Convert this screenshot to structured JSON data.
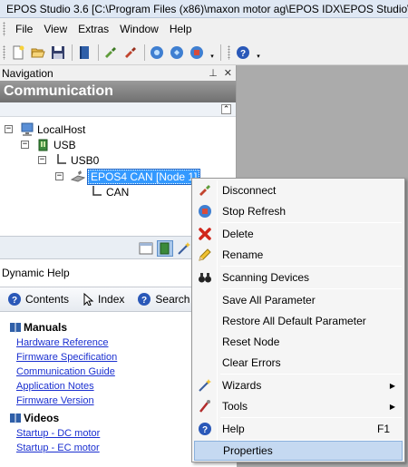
{
  "window": {
    "title": "EPOS Studio 3.6 [C:\\Program Files (x86)\\maxon motor ag\\EPOS IDX\\EPOS Studio\\"
  },
  "menubar": {
    "items": [
      {
        "label": "File"
      },
      {
        "label": "View"
      },
      {
        "label": "Extras"
      },
      {
        "label": "Window"
      },
      {
        "label": "Help"
      }
    ]
  },
  "toolbar": {
    "dropdown_glyph": "▾",
    "buttons": [
      "new-file-icon",
      "open-folder-icon",
      "save-icon",
      "book-icon",
      "connect-icon",
      "disconnect-icon",
      "node-1-icon",
      "node-2-icon",
      "node-3-icon",
      "help-icon"
    ]
  },
  "navigation": {
    "title": "Navigation",
    "pin_glyph": "⊥",
    "close_glyph": "✕",
    "panel_title": "Communication",
    "collapse_glyph": "⌃",
    "tree": [
      {
        "label": "LocalHost",
        "expander": "−"
      },
      {
        "label": "USB",
        "expander": "−"
      },
      {
        "label": "USB0",
        "expander": "−"
      },
      {
        "label": "EPOS4 CAN [Node 1]",
        "expander": "−",
        "selected": true
      },
      {
        "label": "CAN"
      }
    ]
  },
  "dynamic_help": {
    "title": "Dynamic Help",
    "tabs": [
      {
        "label": "Contents"
      },
      {
        "label": "Index"
      },
      {
        "label": "Search"
      }
    ],
    "sections": [
      {
        "title": "Manuals",
        "links": [
          "Hardware Reference",
          "Firmware Specification",
          "Communication Guide",
          "Application Notes",
          "Firmware Version"
        ]
      },
      {
        "title": "Videos",
        "links": [
          "Startup - DC motor",
          "Startup - EC motor"
        ]
      }
    ]
  },
  "context_menu": {
    "items": [
      {
        "label": "Disconnect",
        "icon": "disconnect-icon"
      },
      {
        "label": "Stop Refresh",
        "icon": "stop-refresh-icon"
      },
      {
        "label": "Delete",
        "icon": "delete-icon"
      },
      {
        "label": "Rename",
        "icon": "pencil-icon"
      },
      {
        "label": "Scanning Devices",
        "icon": "binoculars-icon"
      },
      {
        "label": "Save All Parameter"
      },
      {
        "label": "Restore All Default Parameter"
      },
      {
        "label": "Reset Node"
      },
      {
        "label": "Clear Errors"
      },
      {
        "label": "Wizards",
        "icon": "wand-icon",
        "submenu": "▶"
      },
      {
        "label": "Tools",
        "icon": "tools-icon",
        "submenu": "▶"
      },
      {
        "label": "Help",
        "icon": "help-icon",
        "shortcut": "F1"
      },
      {
        "label": "Properties",
        "highlighted": true
      }
    ]
  },
  "colors": {
    "selection": "#3399ff",
    "menu_highlight": "#c5d9f1",
    "link": "#1a2fd0",
    "header_gradient_top": "#9a9a9a"
  }
}
